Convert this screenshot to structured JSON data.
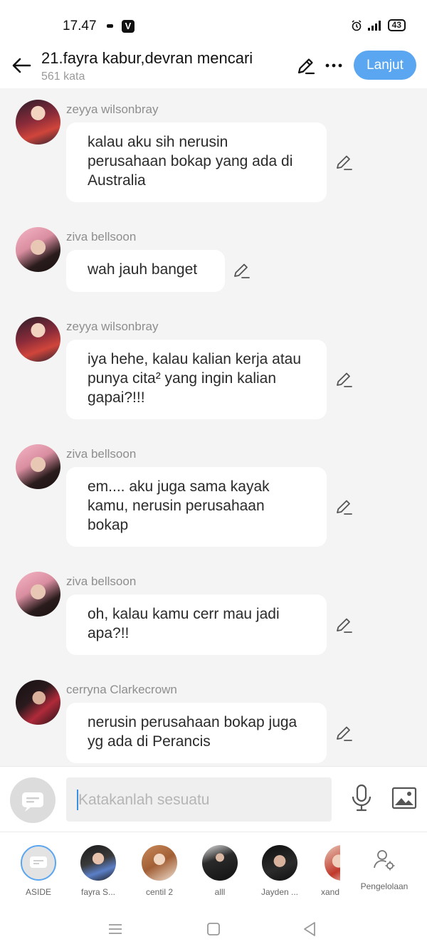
{
  "status_bar": {
    "time": "17.47",
    "app_badge": "V",
    "battery": "43"
  },
  "header": {
    "title": "21.fayra kabur,devran mencari",
    "word_count": "561 kata",
    "next_label": "Lanjut"
  },
  "messages": [
    {
      "sender": "zeyya wilsonbray",
      "text": "kalau aku sih nerusin perusahaan bokap yang ada di Australia"
    },
    {
      "sender": "ziva bellsoon",
      "text": "wah jauh banget"
    },
    {
      "sender": "zeyya wilsonbray",
      "text": "iya hehe, kalau kalian kerja atau punya cita² yang ingin kalian gapai?!!!"
    },
    {
      "sender": "ziva bellsoon",
      "text": "em.... aku juga sama kayak kamu, nerusin perusahaan bokap"
    },
    {
      "sender": "ziva bellsoon",
      "text": "oh, kalau kamu cerr mau jadi apa?!!"
    },
    {
      "sender": "cerryna Clarkecrown",
      "text": "nerusin perusahaan bokap juga yg ada di Perancis"
    }
  ],
  "composer": {
    "placeholder": "Katakanlah sesuatu"
  },
  "characters": [
    {
      "name": "ASIDE"
    },
    {
      "name": "fayra S..."
    },
    {
      "name": "centil 2"
    },
    {
      "name": "alll"
    },
    {
      "name": "Jayden ..."
    },
    {
      "name": "xand"
    }
  ],
  "manage_label": "Pengelolaan",
  "colors": {
    "accent": "#5aa6f0",
    "background": "#f4f4f4",
    "bubble": "#ffffff",
    "sender_text": "#8e8e8e"
  },
  "icons": {
    "header": [
      "back-arrow-icon",
      "pencil-icon",
      "more-icon"
    ],
    "composer": [
      "chat-bubble-icon",
      "microphone-icon",
      "image-icon"
    ],
    "nav": [
      "menu-icon",
      "home-icon",
      "back-triangle-icon"
    ]
  }
}
